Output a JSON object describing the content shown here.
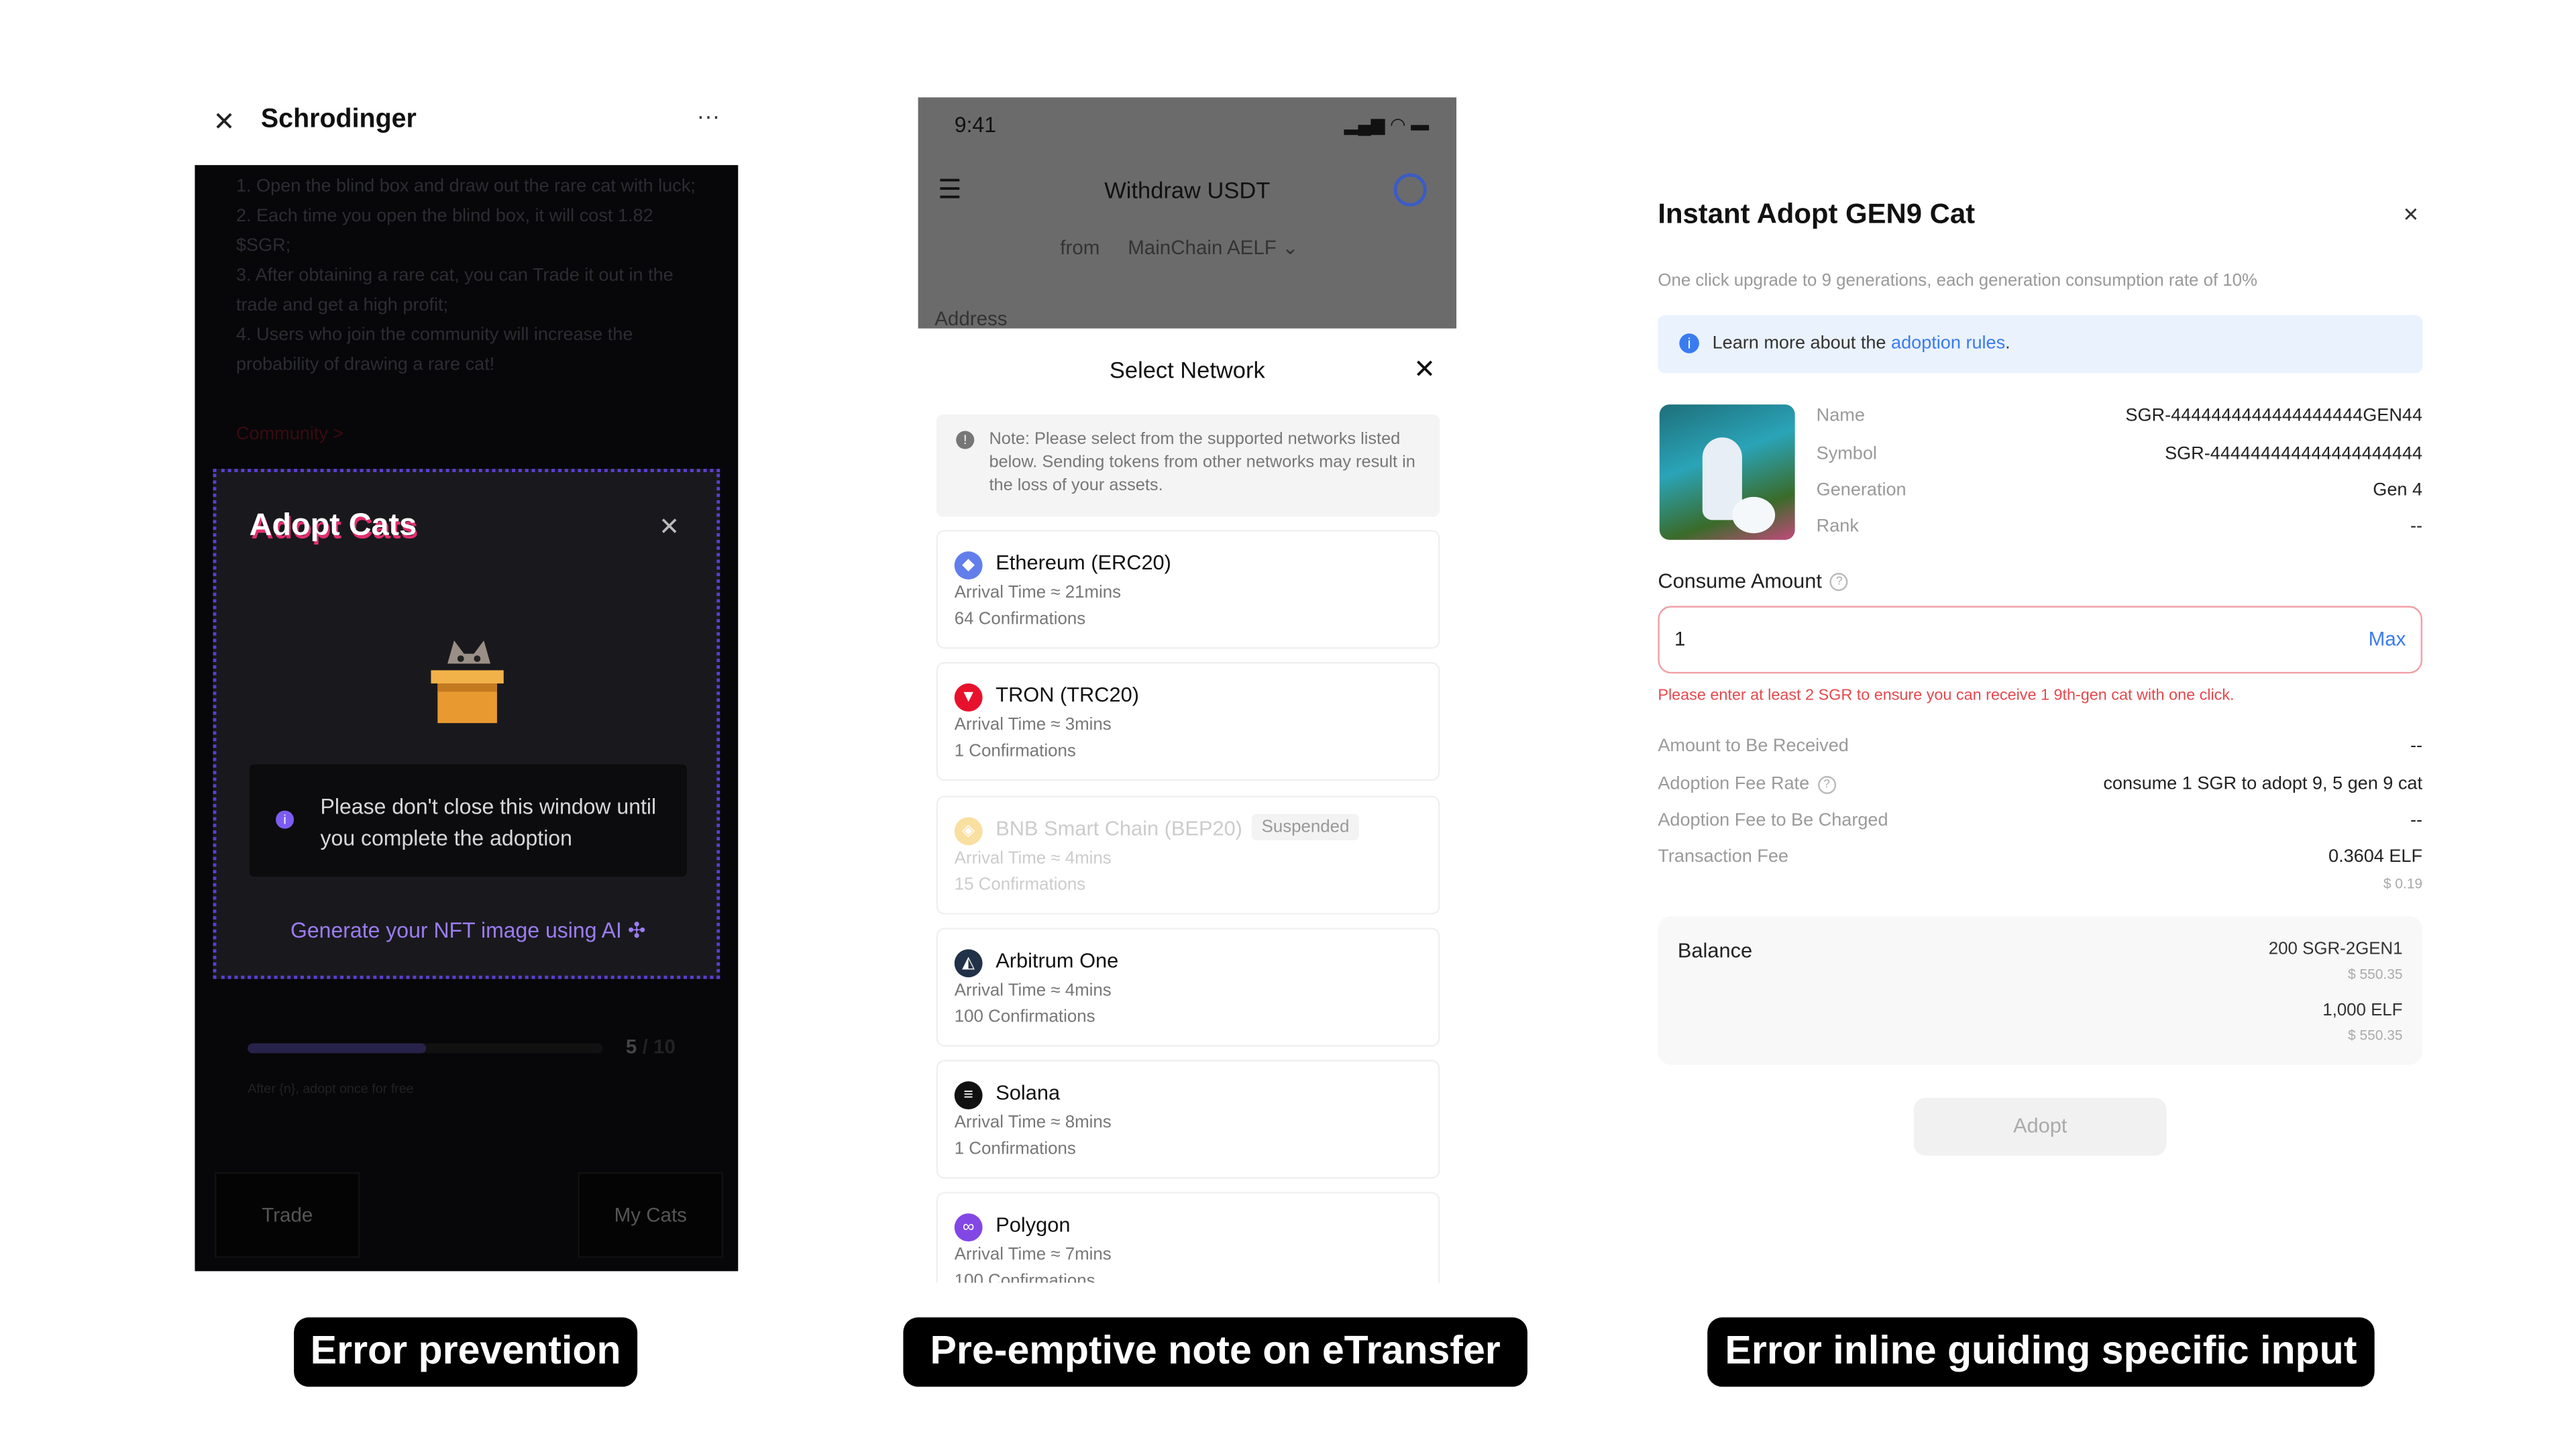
{
  "panel1": {
    "title": "Schrodinger",
    "more": "···",
    "rules": [
      "1. Open the blind box and draw out the rare cat with luck;",
      "2. Each time you open the blind box, it will cost 1.82 $SGR;",
      "3. After obtaining a rare cat, you can Trade it out in the trade and get a high profit;",
      "4. Users who join the community will increase the probability of drawing a rare cat!"
    ],
    "community_link": "Community >",
    "modal": {
      "title": "Adopt Cats",
      "info": "Please don't close this window until you complete the adoption",
      "generate_link": "Generate your NFT image using AI"
    },
    "progress": {
      "current": "5",
      "sep": "/",
      "total": "10",
      "fraction": 0.5,
      "note": "After {n}, adopt once for free"
    },
    "buttons": {
      "trade": "Trade",
      "my_cats": "My Cats"
    },
    "caption": "Error prevention"
  },
  "panel2": {
    "status_time": "9:41",
    "title": "Withdraw USDT",
    "from_label": "from",
    "from_value": "MainChain AELF",
    "address_label": "Address",
    "sheet_title": "Select Network",
    "note": "Note: Please select from the supported networks listed below. Sending tokens from other networks may result in the loss of your assets.",
    "networks": [
      {
        "name": "Ethereum (ERC20)",
        "arrival": "Arrival Time ≈ 21mins",
        "confirmations": "64 Confirmations",
        "color": "#627eea"
      },
      {
        "name": "TRON (TRC20)",
        "arrival": "Arrival Time ≈ 3mins",
        "confirmations": "1 Confirmations",
        "color": "#e8112d"
      },
      {
        "name": "BNB Smart Chain (BEP20)",
        "arrival": "Arrival Time ≈ 4mins",
        "confirmations": "15 Confirmations",
        "color": "#f3ba2f",
        "badge": "Suspended"
      },
      {
        "name": "Arbitrum One",
        "arrival": "Arrival Time ≈ 4mins",
        "confirmations": "100 Confirmations",
        "color": "#213147"
      },
      {
        "name": "Solana",
        "arrival": "Arrival Time ≈ 8mins",
        "confirmations": "1 Confirmations",
        "color": "#111111"
      },
      {
        "name": "Polygon",
        "arrival": "Arrival Time ≈ 7mins",
        "confirmations": "100 Confirmations",
        "color": "#8247e5"
      }
    ],
    "caption": "Pre-emptive note on eTransfer"
  },
  "panel3": {
    "title": "Instant Adopt GEN9 Cat",
    "subtitle": "One click upgrade to 9 generations, each generation consumption rate of 10%",
    "banner_text": "Learn more about the ",
    "banner_link": "adoption rules",
    "banner_end": ".",
    "info": [
      {
        "label": "Name",
        "value": "SGR-4444444444444444444GEN44"
      },
      {
        "label": "Symbol",
        "value": "SGR-444444444444444444444"
      },
      {
        "label": "Generation",
        "value": "Gen 4"
      },
      {
        "label": "Rank",
        "value": "--"
      }
    ],
    "consume_label": "Consume Amount",
    "input_value": "1",
    "max_label": "Max",
    "error": "Please enter at least 2 SGR to ensure you can receive 1 9th-gen cat with one click.",
    "details": [
      {
        "label": "Amount to Be Received",
        "value": "--"
      },
      {
        "label": "Adoption Fee Rate",
        "value": "consume 1 SGR to adopt 9, 5 gen 9 cat"
      },
      {
        "label": "Adoption Fee to Be Charged",
        "value": "--"
      },
      {
        "label": "Transaction Fee",
        "value": "0.3604 ELF",
        "sub": "$ 0.19"
      }
    ],
    "balance_label": "Balance",
    "balances": [
      {
        "amount": "200 SGR-2GEN1",
        "usd": "$ 550.35"
      },
      {
        "amount": "1,000 ELF",
        "usd": "$ 550.35"
      }
    ],
    "adopt_label": "Adopt",
    "caption": "Error inline guiding specific input",
    "error_color": "#e5484d",
    "link_color": "#3a7bf0"
  }
}
